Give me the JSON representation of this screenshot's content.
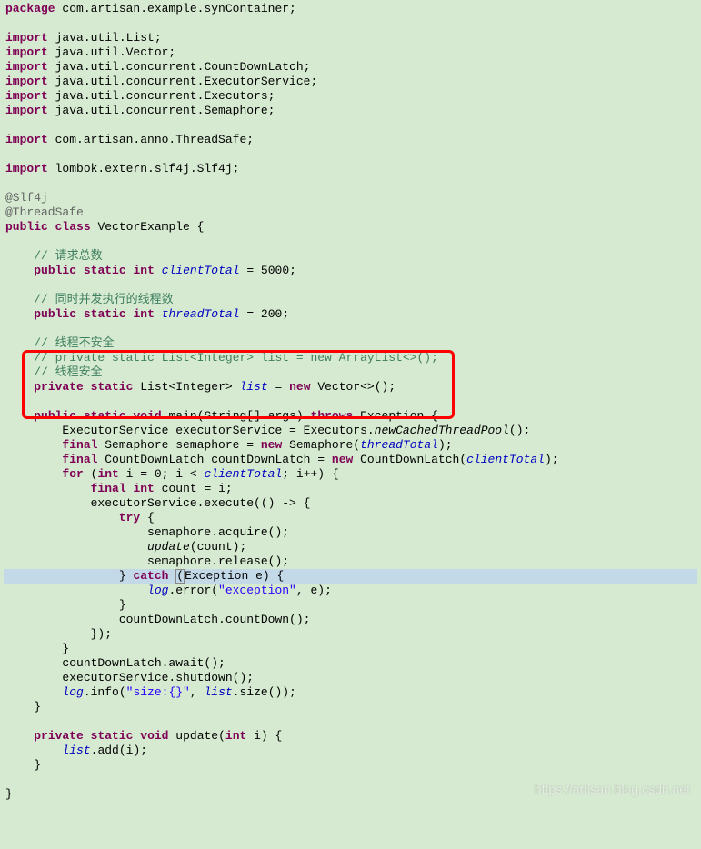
{
  "code": {
    "pkg_kw": "package",
    "pkg_name": " com.artisan.example.synContainer;",
    "import_kw": "import",
    "imp1": " java.util.List;",
    "imp2": " java.util.Vector;",
    "imp3": " java.util.concurrent.CountDownLatch;",
    "imp4": " java.util.concurrent.ExecutorService;",
    "imp5": " java.util.concurrent.Executors;",
    "imp6": " java.util.concurrent.Semaphore;",
    "imp7": " com.artisan.anno.ThreadSafe;",
    "imp8": " lombok.extern.slf4j.Slf4j;",
    "anno1": "@Slf4j",
    "anno2": "@ThreadSafe",
    "public_kw": "public",
    "class_kw": "class",
    "class_name": " VectorExample {",
    "com1": "    // 请求总数",
    "static_kw": "static",
    "int_kw": "int",
    "field1": "clientTotal",
    "field1_val": " = 5000;",
    "com2": "    // 同时并发执行的线程数",
    "field2": "threadTotal",
    "field2_val": " = 200;",
    "com3": "    // 线程不安全",
    "com4": "    // private static List<Integer> list = new ArrayList<>();",
    "com5": "    // 线程安全",
    "private_kw": "private",
    "list_type": " List<Integer> ",
    "list_field": "list",
    "new_kw": "new",
    "vector_ctor": " Vector<>();",
    "void_kw": "void",
    "main_name": " main(String[] args) ",
    "throws_kw": "throws",
    "exception_tail": " Exception {",
    "es_line_a": "        ExecutorService executorService = Executors.",
    "es_line_b": "newCachedThreadPool",
    "es_line_c": "();",
    "final_kw": "final",
    "sem_a": " Semaphore semaphore = ",
    "sem_b": " Semaphore(",
    "sem_c": ");",
    "cdl_a": " CountDownLatch countDownLatch = ",
    "cdl_b": " CountDownLatch(",
    "cdl_c": ");",
    "for_kw": "for",
    "for_a": " (",
    "for_b": " i = 0; i < ",
    "for_c": "; i++) {",
    "count_a": " count = i;",
    "exec_a": "            executorService.execute(() -> {",
    "try_kw": "try",
    "try_tail": " {",
    "acq": "                    semaphore.acquire();",
    "upd_call_a": "                    ",
    "upd_call_b": "update",
    "upd_call_c": "(count);",
    "rel": "                    semaphore.release();",
    "catch_a": "                } ",
    "catch_kw": "catch",
    "catch_b": " ",
    "catch_paren": "(",
    "catch_c": "Exception e) {",
    "log_err_a": "                    ",
    "log_err_b": "log",
    "log_err_c": ".error(",
    "log_err_str": "\"exception\"",
    "log_err_d": ", e);",
    "close1": "                }",
    "cdl_down": "                countDownLatch.countDown();",
    "close2": "            });",
    "close3": "        }",
    "await": "        countDownLatch.await();",
    "shutdown": "        executorService.shutdown();",
    "loginfo_a": "        ",
    "loginfo_b": "log",
    "loginfo_c": ".info(",
    "loginfo_str": "\"size:{}\"",
    "loginfo_d": ", ",
    "loginfo_e": ".size());",
    "close4": "    }",
    "upd_a": " update(",
    "upd_b": " i) {",
    "add_a": "        ",
    "add_b": ".add(i);",
    "close5": "    }",
    "close6": "}",
    "sp1": " ",
    "sp4": "    ",
    "sp8": "        ",
    "sp12": "            ",
    "sp16": "                ",
    "eq_new": " = "
  },
  "watermark": "https://artisan.blog.csdn.net"
}
